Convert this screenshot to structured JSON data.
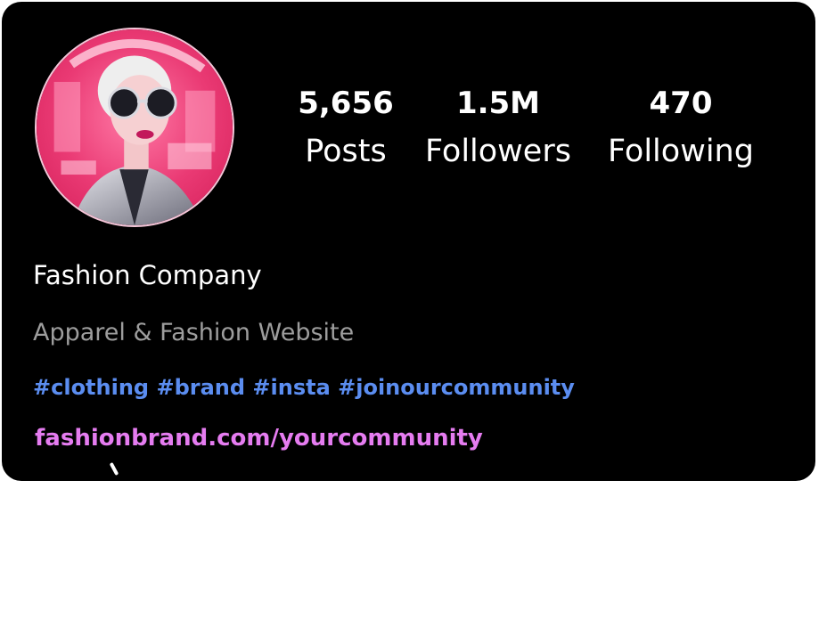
{
  "profile": {
    "stats": [
      {
        "value": "5,656",
        "label": "Posts"
      },
      {
        "value": "1.5M",
        "label": "Followers"
      },
      {
        "value": "470",
        "label": "Following"
      }
    ],
    "name": "Fashion Company",
    "category": "Apparel & Fashion Website",
    "hashtags": "#clothing #brand #insta #joinourcommunity",
    "link": "fashionbrand.com/yourcommunity"
  },
  "colors": {
    "card_background": "#000000",
    "hashtag": "#5b8df0",
    "link": "#e57cf0",
    "category_text": "#9d9d9d",
    "avatar_pink": "#e8336e"
  },
  "icons": {
    "avatar": "profile-avatar-image"
  }
}
